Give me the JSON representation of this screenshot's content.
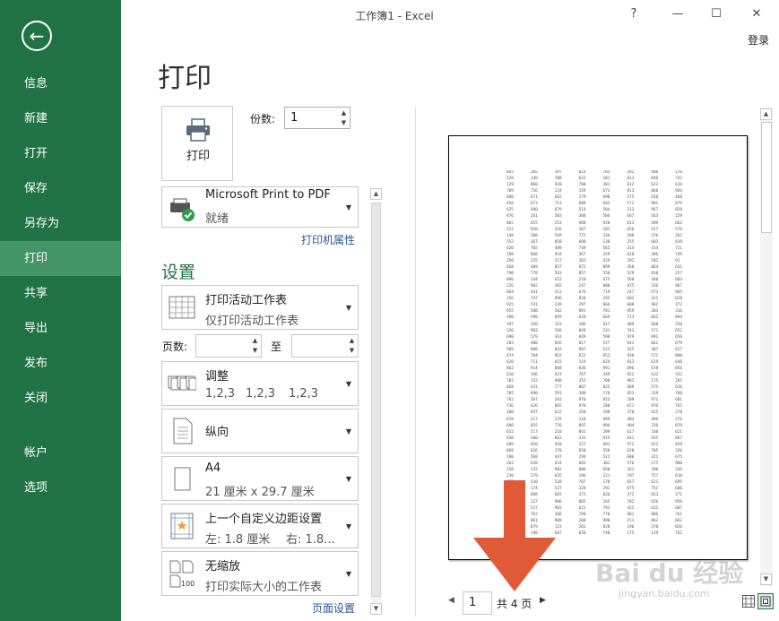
{
  "window": {
    "title": "工作簿1 - Excel",
    "help": "?",
    "minimize": "—",
    "maximize": "☐",
    "close": "✕",
    "login": "登录"
  },
  "nav": {
    "back_icon": "back-arrow-icon",
    "items": [
      {
        "label": "信息"
      },
      {
        "label": "新建"
      },
      {
        "label": "打开"
      },
      {
        "label": "保存"
      },
      {
        "label": "另存为"
      },
      {
        "label": "打印"
      },
      {
        "label": "共享"
      },
      {
        "label": "导出"
      },
      {
        "label": "发布"
      },
      {
        "label": "关闭"
      },
      {
        "label": "帐户"
      },
      {
        "label": "选项"
      }
    ],
    "active_index": 5
  },
  "page": {
    "title": "打印"
  },
  "print": {
    "button_label": "打印",
    "copies_label": "份数:",
    "copies_value": "1"
  },
  "printer": {
    "name": "Microsoft Print to PDF",
    "status": "就绪",
    "properties_link": "打印机属性"
  },
  "settings": {
    "heading": "设置",
    "scope": {
      "title": "打印活动工作表",
      "sub": "仅打印活动工作表"
    },
    "pages_label": "页数:",
    "to_label": "至",
    "collate": {
      "title": "调整",
      "sub": [
        "1,2,3",
        "1,2,3",
        "1,2,3"
      ]
    },
    "orientation": {
      "title": "纵向"
    },
    "paper": {
      "title": "A4",
      "sub": "21 厘米 x 29.7 厘米"
    },
    "margins": {
      "title": "上一个自定义边距设置",
      "sub_left": "左:  1.8 厘米",
      "sub_right": "右:  1.8..."
    },
    "scaling": {
      "title": "无缩放",
      "sub": "打印实际大小的工作表",
      "icon_text": "100"
    },
    "page_setup_link": "页面设置"
  },
  "preview": {
    "current_page": "1",
    "total_pages": "共 4 页",
    "grid_rows": [
      [
        "865",
        "205",
        "397",
        "814",
        "705",
        "282",
        "408",
        "170"
      ],
      [
        "528",
        "149",
        "708",
        "633",
        "181",
        "813",
        "840",
        "742"
      ],
      [
        "129",
        "860",
        "920",
        "700",
        "381",
        "612",
        "622",
        "616"
      ],
      [
        "709",
        "756",
        "224",
        "159",
        "673",
        "813",
        "060",
        "966"
      ],
      [
        "600",
        "671",
        "662",
        "179",
        "698",
        "575",
        "658",
        "468"
      ],
      [
        "450",
        "673",
        "713",
        "680",
        "603",
        "572",
        "981",
        "879"
      ],
      [
        "625",
        "480",
        "679",
        "514",
        "504",
        "312",
        "967",
        "820"
      ],
      [
        "976",
        "261",
        "503",
        "308",
        "506",
        "667",
        "563",
        "229"
      ],
      [
        "865",
        "655",
        "253",
        "968",
        "920",
        "613",
        "589",
        "662"
      ],
      [
        "222",
        "920",
        "326",
        "367",
        "181",
        "656",
        "527",
        "570"
      ],
      [
        "148",
        "308",
        "569",
        "772",
        "336",
        "208",
        "376",
        "262"
      ],
      [
        "552",
        "367",
        "858",
        "600",
        "138",
        "255",
        "603",
        "819"
      ],
      [
        "620",
        "765",
        "409",
        "749",
        "565",
        "314",
        "314",
        "721"
      ],
      [
        "198",
        "960",
        "918",
        "367",
        "359",
        "620",
        "306",
        "749"
      ],
      [
        "350",
        "225",
        "517",
        "303",
        "429",
        "392",
        "582",
        "91"
      ],
      [
        "468",
        "409",
        "857",
        "872",
        "099",
        "350",
        "864",
        "631"
      ],
      [
        "790",
        "778",
        "563",
        "857",
        "558",
        "529",
        "810",
        "257"
      ],
      [
        "096",
        "244",
        "652",
        "210",
        "675",
        "568",
        "340",
        "603"
      ],
      [
        "226",
        "902",
        "302",
        "247",
        "800",
        "075",
        "326",
        "967"
      ],
      [
        "864",
        "441",
        "411",
        "676",
        "719",
        "247",
        "673",
        "965"
      ],
      [
        "356",
        "747",
        "996",
        "820",
        "192",
        "602",
        "231",
        "628"
      ],
      [
        "925",
        "541",
        "239",
        "297",
        "066",
        "608",
        "962",
        "372"
      ],
      [
        "955",
        "580",
        "502",
        "891",
        "781",
        "959",
        "203",
        "316"
      ],
      [
        "190",
        "590",
        "859",
        "620",
        "669",
        "713",
        "662",
        "894"
      ],
      [
        "197",
        "350",
        "153",
        "206",
        "817",
        "409",
        "660",
        "250"
      ],
      [
        "126",
        "903",
        "560",
        "849",
        "231",
        "743",
        "571",
        "652"
      ],
      [
        "690",
        "579",
        "361",
        "849",
        "598",
        "929",
        "891",
        "656"
      ],
      [
        "203",
        "400",
        "845",
        "817",
        "527",
        "641",
        "662",
        "679"
      ],
      [
        "909",
        "800",
        "843",
        "907",
        "522",
        "425",
        "307",
        "627"
      ],
      [
        "474",
        "704",
        "963",
        "622",
        "853",
        "930",
        "572",
        "808"
      ],
      [
        "620",
        "711",
        "815",
        "119",
        "824",
        "813",
        "619",
        "640"
      ],
      [
        "862",
        "914",
        "868",
        "836",
        "991",
        "696",
        "678",
        "856"
      ],
      [
        "610",
        "196",
        "621",
        "767",
        "349",
        "922",
        "632",
        "332"
      ],
      [
        "702",
        "152",
        "908",
        "352",
        "708",
        "981",
        "175",
        "265"
      ],
      [
        "868",
        "631",
        "777",
        "807",
        "825",
        "609",
        "575",
        "616"
      ],
      [
        "785",
        "990",
        "591",
        "308",
        "178",
        "653",
        "329",
        "760"
      ],
      [
        "762",
        "567",
        "201",
        "970",
        "823",
        "209",
        "971",
        "601"
      ],
      [
        "736",
        "426",
        "065",
        "970",
        "208",
        "651",
        "976",
        "765"
      ],
      [
        "200",
        "697",
        "622",
        "350",
        "198",
        "370",
        "925",
        "278"
      ],
      [
        "678",
        "317",
        "225",
        "118",
        "999",
        "404",
        "496",
        "276"
      ],
      [
        "690",
        "855",
        "776",
        "897",
        "996",
        "404",
        "226",
        "879"
      ],
      [
        "652",
        "517",
        "210",
        "841",
        "209",
        "617",
        "330",
        "621"
      ],
      [
        "930",
        "500",
        "062",
        "333",
        "915",
        "641",
        "935",
        "867"
      ],
      [
        "689",
        "920",
        "920",
        "227",
        "901",
        "972",
        "922",
        "829"
      ],
      [
        "869",
        "626",
        "370",
        "650",
        "558",
        "620",
        "705",
        "320"
      ],
      [
        "190",
        "560",
        "447",
        "294",
        "522",
        "680",
        "321",
        "675"
      ],
      [
        "262",
        "628",
        "624",
        "683",
        "301",
        "576",
        "275",
        "900"
      ],
      [
        "258",
        "232",
        "902",
        "800",
        "660",
        "261",
        "290",
        "336"
      ],
      [
        "230",
        "279",
        "635",
        "196",
        "221",
        "197",
        "757",
        "610"
      ],
      [
        "678",
        "520",
        "528",
        "707",
        "178",
        "657",
        "621",
        "695"
      ],
      [
        "652",
        "174",
        "527",
        "320",
        "291",
        "675",
        "752",
        "606"
      ],
      [
        "679",
        "868",
        "665",
        "373",
        "026",
        "372",
        "653",
        "271"
      ],
      [
        "780",
        "127",
        "906",
        "865",
        "265",
        "702",
        "656",
        "956"
      ],
      [
        "630",
        "527",
        "903",
        "621",
        "793",
        "425",
        "621",
        "607"
      ],
      [
        "800",
        "762",
        "266",
        "790",
        "770",
        "801",
        "806",
        "761"
      ],
      [
        "650",
        "861",
        "909",
        "200",
        "990",
        "151",
        "062",
        "662"
      ],
      [
        "320",
        "879",
        "123",
        "201",
        "820",
        "196",
        "370",
        "826"
      ],
      [
        "250",
        "190",
        "607",
        "650",
        "740",
        "175",
        "139",
        "762"
      ]
    ]
  },
  "watermark": {
    "text": "Bai du 经验",
    "sub": "jingyan.baidu.com"
  },
  "colors": {
    "nav_bg": "#217346",
    "nav_active": "#439467",
    "accent_text": "#217346",
    "link": "#2b579a",
    "arrow": "#e05a37"
  }
}
